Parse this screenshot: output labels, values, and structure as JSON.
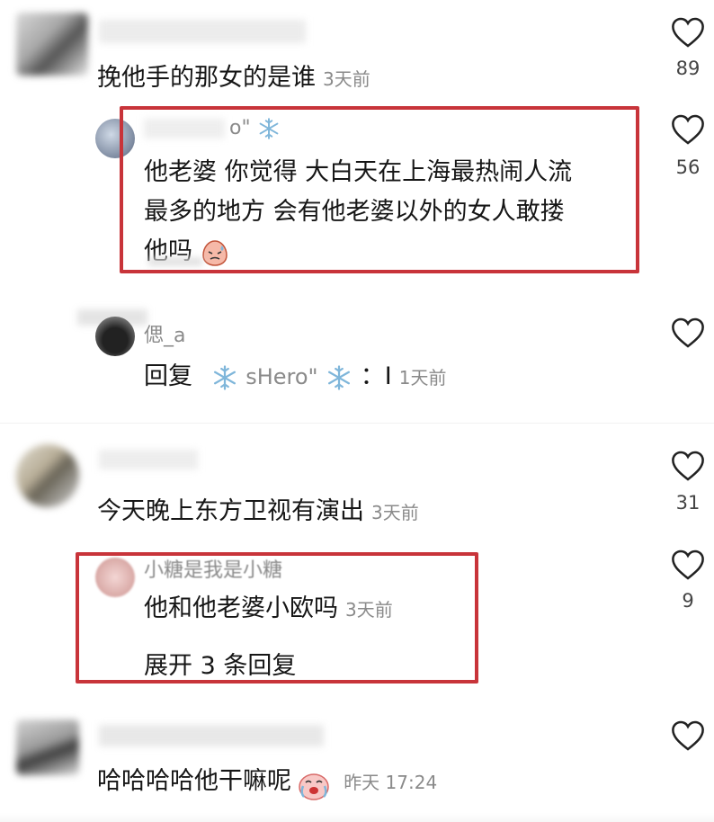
{
  "comments": [
    {
      "text": "挽他手的那女的是谁",
      "time": "3天前",
      "likes": "89",
      "reply": {
        "name_suffix": "o\"",
        "line1": "他老婆  你觉得  大白天在上海最热闹人流",
        "line2": "最多的地方  会有他老婆以外的女人敢搂",
        "line3": "他吗",
        "likes": "56"
      },
      "reply2": {
        "name": "偲_a",
        "reply_label": "回复",
        "target": "sHero\"",
        "colon": "：",
        "bar": "I",
        "time": "1天前"
      }
    },
    {
      "text": "今天晚上东方卫视有演出",
      "time": "3天前",
      "likes": "31",
      "reply": {
        "name": "小糖是我是小糖",
        "text": "他和他老婆小欧吗",
        "time": "3天前",
        "likes": "9",
        "expand": "展开 3 条回复"
      }
    },
    {
      "text": "哈哈哈哈他干嘛呢",
      "time": "昨天 17:24"
    }
  ],
  "icons": {
    "heart": "heart-outline-icon",
    "snow": "snowflake-icon",
    "emoji_sweat": "sweat-face-icon",
    "emoji_cry": "crying-face-icon"
  },
  "colors": {
    "highlight_border": "#c8343a",
    "secondary_text": "#8a8a8a"
  }
}
